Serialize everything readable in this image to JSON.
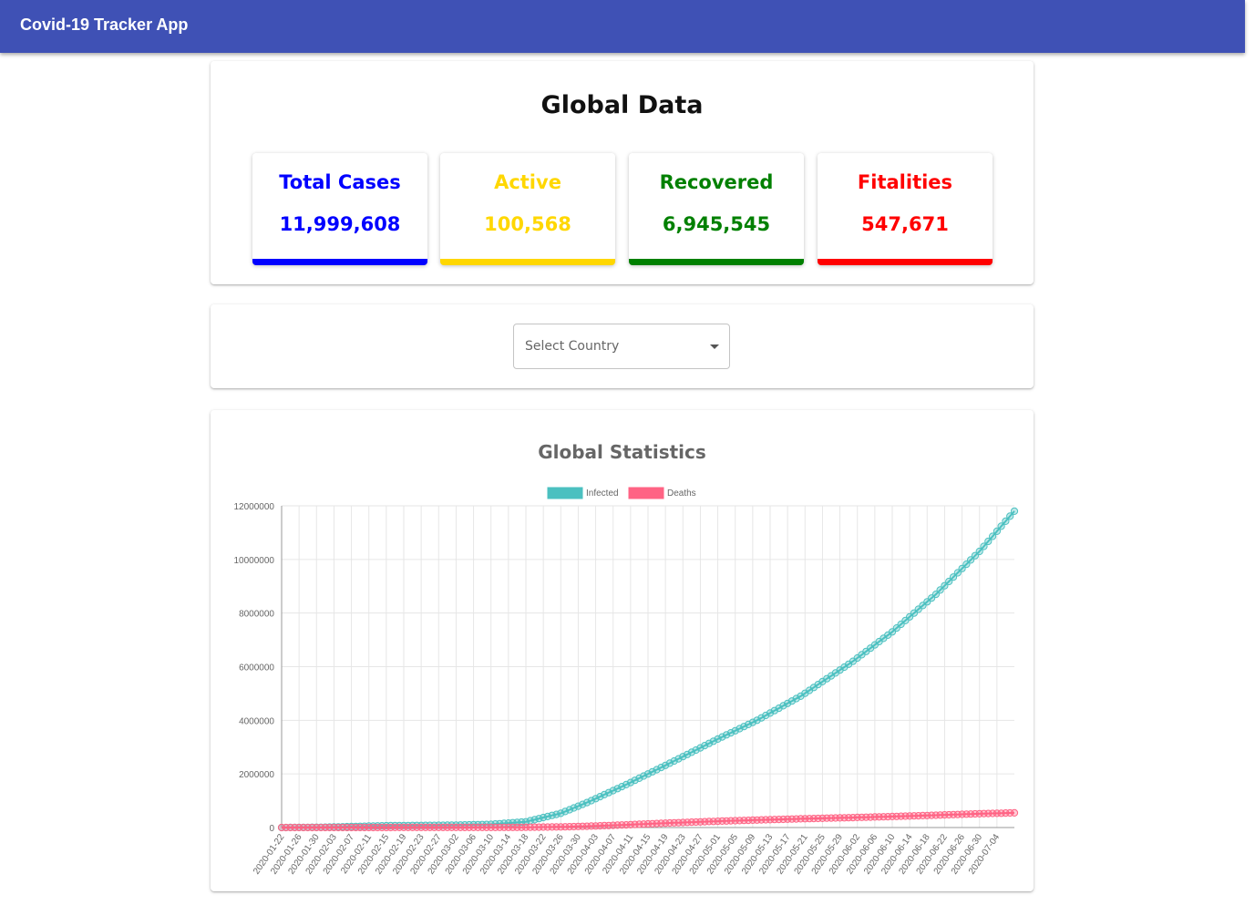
{
  "appbar": {
    "title": "Covid-19 Tracker App"
  },
  "global": {
    "title": "Global Data",
    "cards": [
      {
        "label": "Total Cases",
        "value": "11,999,608",
        "color": "#0000ff"
      },
      {
        "label": "Active",
        "value": "100,568",
        "color": "#ffd700"
      },
      {
        "label": "Recovered",
        "value": "6,945,545",
        "color": "#008000"
      },
      {
        "label": "Fitalities",
        "value": "547,671",
        "color": "#ff0000"
      }
    ]
  },
  "country_select": {
    "placeholder": "Select Country",
    "icon": "chevron-down-icon"
  },
  "chart_data": {
    "type": "line",
    "title": "Global Statistics",
    "legend_position": "top",
    "grid": true,
    "x_start": "2020-01-22",
    "x_end": "2020-07-08",
    "x_tick_labels": [
      "2020-01-22",
      "2020-01-26",
      "2020-01-30",
      "2020-02-03",
      "2020-02-07",
      "2020-02-11",
      "2020-02-15",
      "2020-02-19",
      "2020-02-23",
      "2020-02-27",
      "2020-03-02",
      "2020-03-06",
      "2020-03-10",
      "2020-03-14",
      "2020-03-18",
      "2020-03-22",
      "2020-03-26",
      "2020-03-30",
      "2020-04-03",
      "2020-04-07",
      "2020-04-11",
      "2020-04-15",
      "2020-04-19",
      "2020-04-23",
      "2020-04-27",
      "2020-05-01",
      "2020-05-05",
      "2020-05-09",
      "2020-05-13",
      "2020-05-17",
      "2020-05-21",
      "2020-05-25",
      "2020-05-29",
      "2020-06-02",
      "2020-06-06",
      "2020-06-10",
      "2020-06-14",
      "2020-06-18",
      "2020-06-22",
      "2020-06-26",
      "2020-06-30",
      "2020-07-04"
    ],
    "y_ticks": [
      "0",
      "2000000",
      "4000000",
      "6000000",
      "8000000",
      "10000000",
      "12000000"
    ],
    "ylim": [
      0,
      12000000
    ],
    "series": [
      {
        "name": "Infected",
        "color": "#4bc0c0",
        "points": [
          [
            "2020-01-22",
            555
          ],
          [
            "2020-02-01",
            12000
          ],
          [
            "2020-02-15",
            69000
          ],
          [
            "2020-03-01",
            88000
          ],
          [
            "2020-03-10",
            119000
          ],
          [
            "2020-03-18",
            215000
          ],
          [
            "2020-03-26",
            530000
          ],
          [
            "2020-04-01",
            930000
          ],
          [
            "2020-04-10",
            1600000
          ],
          [
            "2020-04-20",
            2400000
          ],
          [
            "2020-05-01",
            3300000
          ],
          [
            "2020-05-10",
            4000000
          ],
          [
            "2020-05-20",
            4900000
          ],
          [
            "2020-06-01",
            6200000
          ],
          [
            "2020-06-10",
            7300000
          ],
          [
            "2020-06-20",
            8700000
          ],
          [
            "2020-06-30",
            10300000
          ],
          [
            "2020-07-08",
            11800000
          ]
        ]
      },
      {
        "name": "Deaths",
        "color": "#ff6384",
        "points": [
          [
            "2020-01-22",
            17
          ],
          [
            "2020-02-15",
            1500
          ],
          [
            "2020-03-10",
            4300
          ],
          [
            "2020-03-18",
            9000
          ],
          [
            "2020-03-26",
            24000
          ],
          [
            "2020-04-01",
            47000
          ],
          [
            "2020-04-10",
            100000
          ],
          [
            "2020-04-20",
            170000
          ],
          [
            "2020-05-01",
            235000
          ],
          [
            "2020-05-10",
            280000
          ],
          [
            "2020-05-20",
            325000
          ],
          [
            "2020-06-01",
            372000
          ],
          [
            "2020-06-10",
            410000
          ],
          [
            "2020-06-20",
            460000
          ],
          [
            "2020-06-30",
            515000
          ],
          [
            "2020-07-08",
            547000
          ]
        ]
      }
    ]
  }
}
